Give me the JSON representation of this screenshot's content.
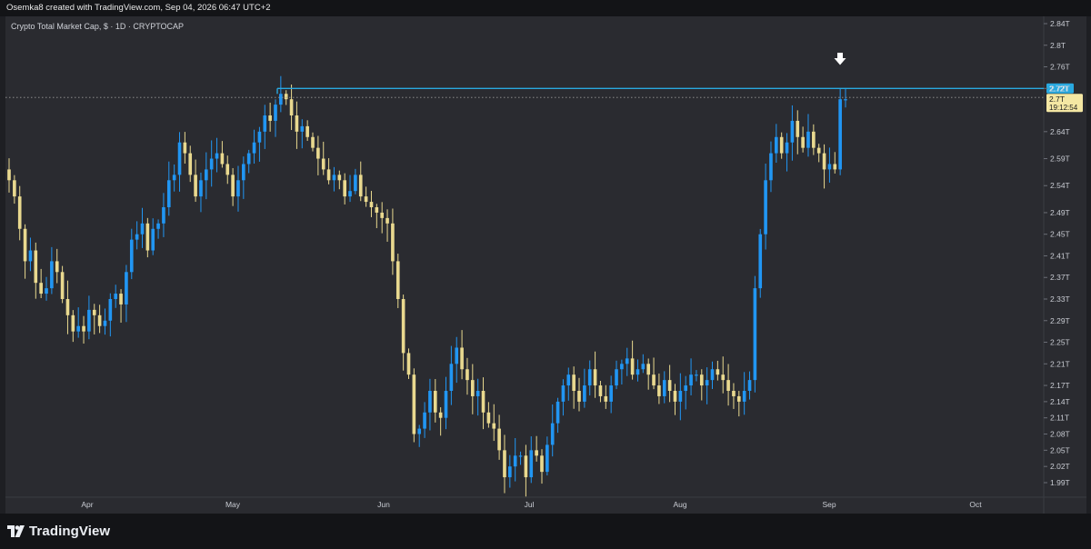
{
  "header": {
    "attribution": "Osemka8 created with TradingView.com, Sep 04, 2026 06:47 UTC+2"
  },
  "chart": {
    "symbol_label": "Crypto Total Market Cap, $ · 1D · CRYPTOCAP"
  },
  "footer": {
    "logo_text": "TradingView"
  },
  "colors": {
    "background": "#2a2b30",
    "up": "#2196f3",
    "down": "#e9d98f",
    "resistance_line": "#29a9e0",
    "last_price_dotted": "#9a9a9a"
  },
  "chart_data": {
    "type": "candlestick",
    "title": "Crypto Total Market Cap, $ · 1D · CRYPTOCAP",
    "unit": "T",
    "y_ticks": [
      "2.84T",
      "2.8T",
      "2.76T",
      "2.72T",
      "2.64T",
      "2.59T",
      "2.54T",
      "2.49T",
      "2.45T",
      "2.41T",
      "2.37T",
      "2.33T",
      "2.29T",
      "2.25T",
      "2.21T",
      "2.17T",
      "2.14T",
      "2.11T",
      "2.08T",
      "2.05T",
      "2.02T",
      "1.99T"
    ],
    "x_ticks": [
      "Apr",
      "May",
      "Jun",
      "Jul",
      "Aug",
      "Sep",
      "Oct"
    ],
    "resistance_level": "2.72T",
    "last_price": "2.7T",
    "countdown": "19:12:54",
    "closes": [
      2.55,
      2.52,
      2.46,
      2.4,
      2.42,
      2.36,
      2.34,
      2.35,
      2.4,
      2.38,
      2.33,
      2.3,
      2.27,
      2.28,
      2.27,
      2.31,
      2.3,
      2.28,
      2.29,
      2.33,
      2.34,
      2.32,
      2.38,
      2.44,
      2.45,
      2.47,
      2.42,
      2.46,
      2.47,
      2.5,
      2.55,
      2.56,
      2.62,
      2.6,
      2.56,
      2.52,
      2.55,
      2.57,
      2.59,
      2.6,
      2.58,
      2.56,
      2.52,
      2.55,
      2.58,
      2.6,
      2.62,
      2.64,
      2.67,
      2.66,
      2.69,
      2.71,
      2.7,
      2.67,
      2.64,
      2.65,
      2.63,
      2.61,
      2.59,
      2.57,
      2.55,
      2.56,
      2.55,
      2.52,
      2.53,
      2.56,
      2.52,
      2.51,
      2.5,
      2.49,
      2.48,
      2.47,
      2.4,
      2.33,
      2.23,
      2.19,
      2.08,
      2.09,
      2.12,
      2.16,
      2.12,
      2.11,
      2.16,
      2.21,
      2.24,
      2.2,
      2.18,
      2.15,
      2.16,
      2.12,
      2.1,
      2.09,
      2.05,
      2.0,
      2.02,
      2.04,
      2.04,
      2.0,
      2.05,
      2.04,
      2.01,
      2.06,
      2.1,
      2.14,
      2.17,
      2.19,
      2.16,
      2.14,
      2.17,
      2.2,
      2.17,
      2.15,
      2.14,
      2.17,
      2.2,
      2.21,
      2.22,
      2.19,
      2.2,
      2.21,
      2.19,
      2.17,
      2.15,
      2.18,
      2.16,
      2.14,
      2.16,
      2.17,
      2.19,
      2.19,
      2.17,
      2.18,
      2.2,
      2.19,
      2.18,
      2.16,
      2.15,
      2.14,
      2.16,
      2.18,
      2.35,
      2.45,
      2.55,
      2.6,
      2.63,
      2.6,
      2.62,
      2.66,
      2.63,
      2.61,
      2.64,
      2.61,
      2.6,
      2.57,
      2.58,
      2.57,
      2.7,
      2.7
    ],
    "ylim": [
      1.98,
      2.85
    ]
  }
}
